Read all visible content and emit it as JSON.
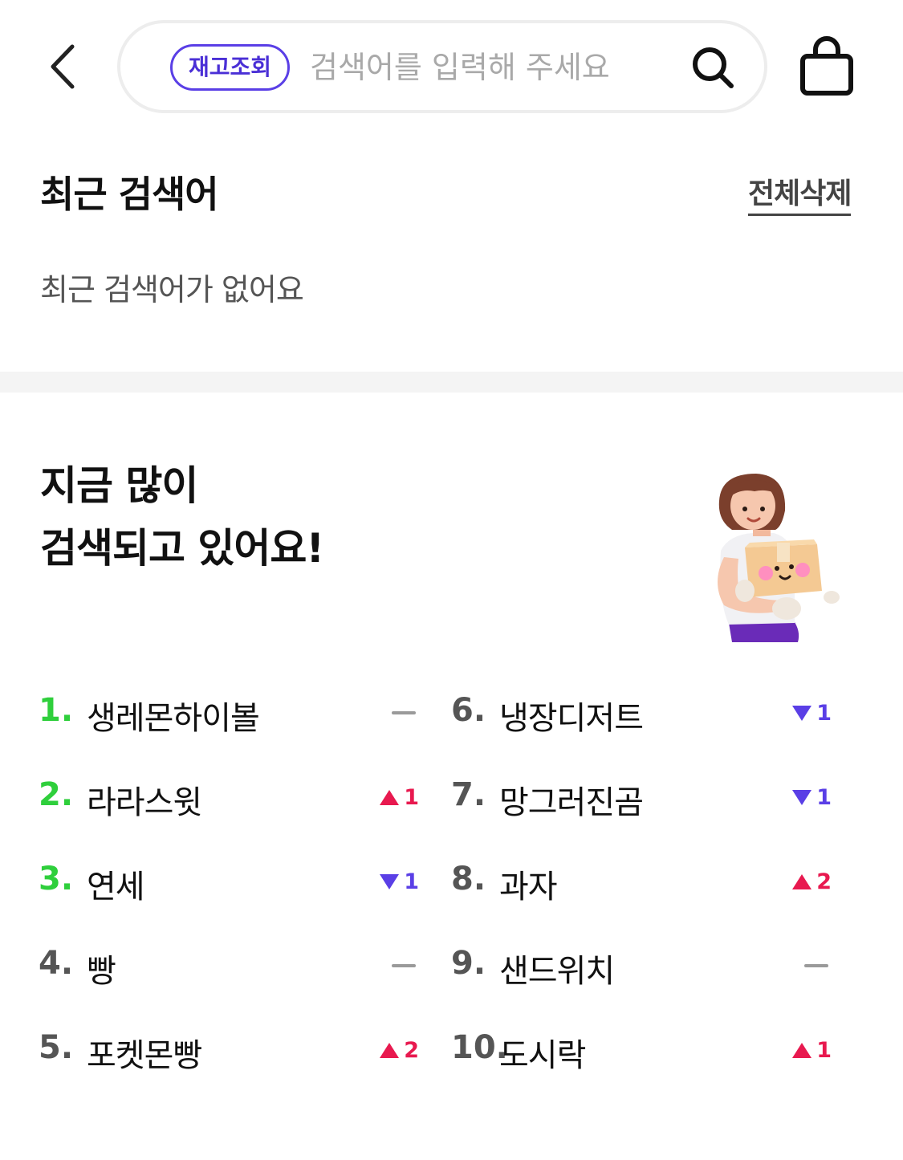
{
  "header": {
    "search_chip": "재고조회",
    "search_placeholder": "검색어를 입력해 주세요",
    "icons": [
      "chevron-left-icon",
      "search-icon",
      "shopping-bag-icon"
    ],
    "accent_color": "#5a3fe6"
  },
  "recent": {
    "title": "최근 검색어",
    "delete_all": "전체삭제",
    "empty_message": "최근 검색어가 없어요"
  },
  "trending": {
    "title_line1": "지금 많이",
    "title_line2": "검색되고 있어요!",
    "top_rank_color": "#2fcf3c",
    "up_color": "#e8194f",
    "down_color": "#5a3fe6",
    "items": [
      {
        "rank": "1.",
        "term": "생레몬하이볼",
        "change": "same",
        "amount": ""
      },
      {
        "rank": "2.",
        "term": "라라스윗",
        "change": "up",
        "amount": "1"
      },
      {
        "rank": "3.",
        "term": "연세",
        "change": "down",
        "amount": "1"
      },
      {
        "rank": "4.",
        "term": "빵",
        "change": "same",
        "amount": ""
      },
      {
        "rank": "5.",
        "term": "포켓몬빵",
        "change": "up",
        "amount": "2"
      },
      {
        "rank": "6.",
        "term": "냉장디저트",
        "change": "down",
        "amount": "1"
      },
      {
        "rank": "7.",
        "term": "망그러진곰",
        "change": "down",
        "amount": "1"
      },
      {
        "rank": "8.",
        "term": "과자",
        "change": "up",
        "amount": "2"
      },
      {
        "rank": "9.",
        "term": "샌드위치",
        "change": "same",
        "amount": ""
      },
      {
        "rank": "10.",
        "term": "도시락",
        "change": "up",
        "amount": "1"
      }
    ]
  }
}
